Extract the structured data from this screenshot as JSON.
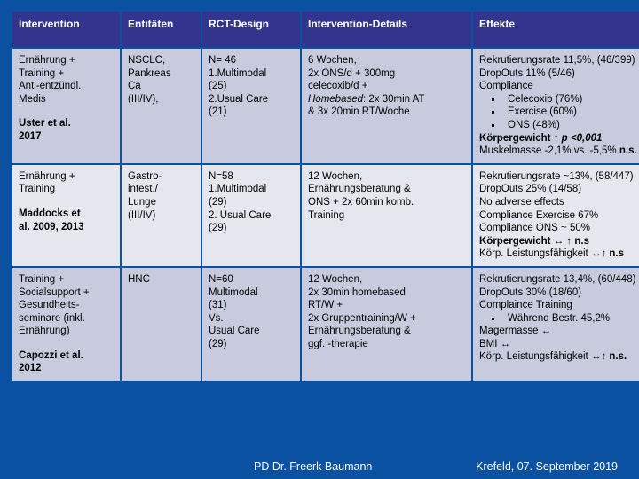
{
  "slide": {
    "background_color": "#0a51a1",
    "header_color": "#33348e",
    "row_color_a": "#c8cbdd",
    "row_color_b": "#e6e7ee"
  },
  "table": {
    "headers": [
      "Intervention",
      "Entitäten",
      "RCT-Design",
      "Intervention-Details",
      "Effekte"
    ],
    "rows": [
      {
        "intervention": "Ernährung +\nTraining +\nAnti-entzündl.\nMedis",
        "reference": "Uster et al.\n2017",
        "entitaeten": "NSCLC,\nPankreas\nCa\n(III/IV),",
        "rct_design": "N= 46\n1.Multimodal\n(25)\n2.Usual Care\n(21)",
        "details_lines": [
          "6 Wochen,",
          "2x ONS/d + 300mg",
          "celecoxib/d +"
        ],
        "details_italic_lead": "Homebased",
        "details_after_italic": ": 2x 30min AT",
        "details_tail": "& 3x 20min RT/Woche",
        "effekte_pre": [
          "Rekrutierungsrate 11,5%, (46/399)",
          "DropOuts 11% (5/46)",
          "Compliance"
        ],
        "effekte_bullets": [
          "Celecoxib (76%)",
          "Exercise (60%)",
          "ONS (48%)"
        ],
        "effekte_bold_line_label": "Körpergewicht ",
        "effekte_bold_line_value": "↑ p <0,001",
        "effekte_last_plain": "Muskelmasse -2,1% vs. -5,5% ",
        "effekte_last_bold": "n.s."
      },
      {
        "intervention": "Ernährung +\nTraining",
        "reference": "Maddocks et\nal. 2009, 2013",
        "entitaeten": "Gastro-\nintest./\nLunge\n(III/IV)",
        "rct_design": "N=58\n1.Multimodal\n(29)\n2. Usual Care\n(29)",
        "details": "12 Wochen,\nErnährungsberatung &\nONS + 2x 60min komb.\nTraining",
        "effekte_pre": [
          "Rekrutierungsrate ~13%, (58/447)",
          "DropOuts 25% (14/58)",
          "No adverse effects",
          "Compliance Exercise 67%",
          "Compliance ONS ~ 50%"
        ],
        "effekte_bold_rows": [
          {
            "bold_head": "Körpergewicht ",
            "plain_mid": "↔ ",
            "bold_tail": "↑ n.s"
          },
          {
            "plain_head": "Körp. Leistungsfähigkeit ↔↑ ",
            "bold_tail": "n.s"
          }
        ]
      },
      {
        "intervention": "Training +\nSocialsupport +\nGesundheits-\nseminare (inkl.\nErnährung)",
        "reference": "Capozzi et al.\n2012",
        "entitaeten": "HNC",
        "rct_design": "N=60\nMultimodal\n(31)\nVs.\nUsual Care\n(29)",
        "details": "12 Wochen,\n2x 30min homebased\nRT/W +\n2x Gruppentraining/W +\nErnährungsberatung &\nggf. -therapie",
        "effekte_pre": [
          "Rekrutierungsrate 13,4%, (60/448)",
          "DropOuts 30% (18/60)",
          "Complaince Training"
        ],
        "effekte_bullets": [
          "Während Bestr. 45,2%"
        ],
        "effekte_post": [
          "Magermasse ↔",
          "BMI ↔"
        ],
        "effekte_last_plain": "Körp. Leistungsfähigkeit ↔↑ ",
        "effekte_last_bold": "n.s."
      }
    ]
  },
  "footer": {
    "author": "PD Dr. Freerk Baumann",
    "place_date": "Krefeld, 07. September 2019"
  }
}
